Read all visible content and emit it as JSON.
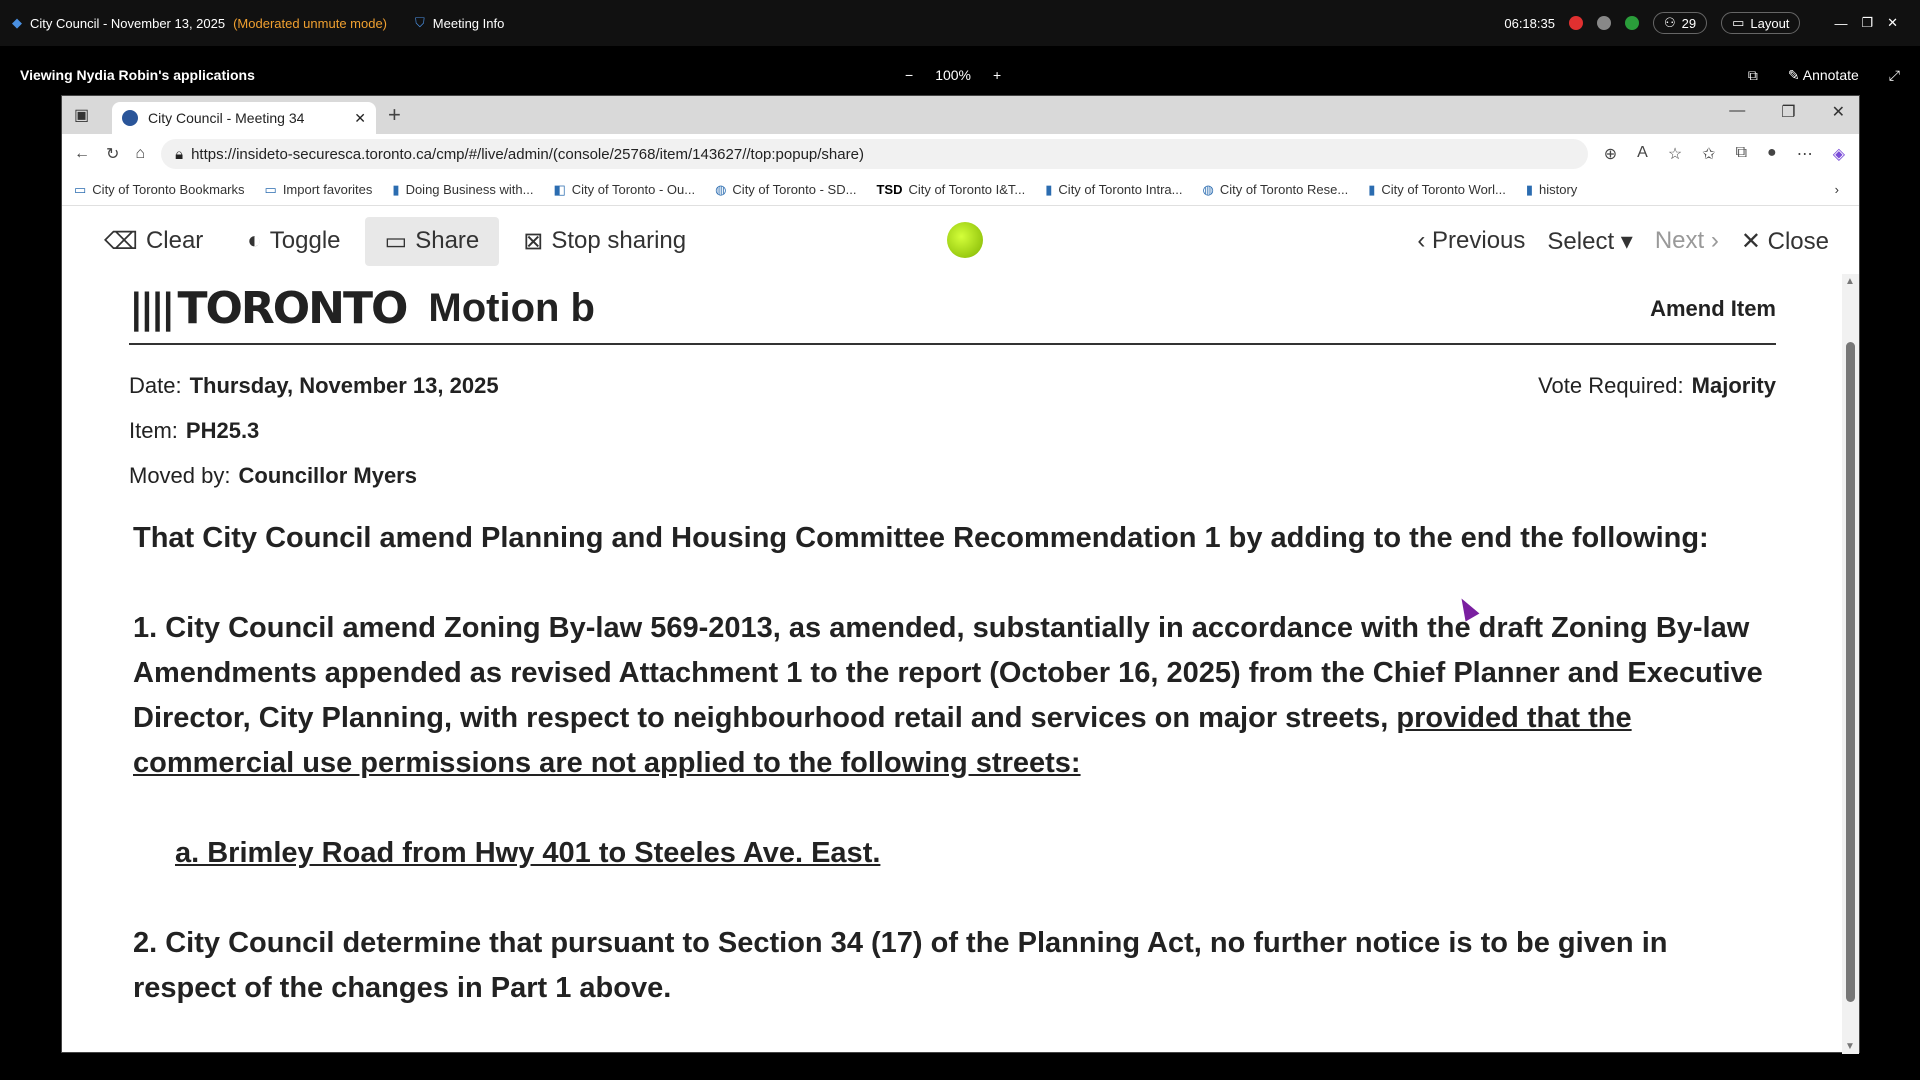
{
  "teams": {
    "meeting_title": "City Council - November 13, 2025",
    "mode": "(Moderated unmute mode)",
    "meeting_info": "Meeting Info",
    "time": "06:18:35",
    "participants": "29",
    "layout": "Layout"
  },
  "viewing": {
    "label": "Viewing Nydia Robin's applications",
    "zoom": "100%",
    "annotate": "Annotate"
  },
  "browser": {
    "tab_title": "City Council - Meeting 34",
    "url": "https://insideto-securesca.toronto.ca/cmp/#/live/admin/(console/25768/item/143627//top:popup/share)",
    "bookmarks": [
      "City of Toronto Bookmarks",
      "Import favorites",
      "Doing Business with...",
      "City of Toronto - Ou...",
      "City of Toronto - SD...",
      "City of Toronto I&T...",
      "City of Toronto Intra...",
      "City of Toronto Rese...",
      "City of Toronto Worl...",
      "history"
    ]
  },
  "toolbar": {
    "clear": "Clear",
    "toggle": "Toggle",
    "share": "Share",
    "stop_sharing": "Stop sharing",
    "previous": "Previous",
    "select": "Select",
    "next": "Next",
    "close": "Close"
  },
  "document": {
    "logo": "TORONTO",
    "motion": "Motion b",
    "amend_item": "Amend Item",
    "date_label": "Date:",
    "date": "Thursday, November 13, 2025",
    "vote_label": "Vote Required:",
    "vote": "Majority",
    "item_label": "Item:",
    "item": "PH25.3",
    "moved_label": "Moved by:",
    "moved": "Councillor Myers",
    "intro": "That City Council amend Planning and Housing Committee Recommendation 1 by adding to the end the following:",
    "p1": "1. City Council amend Zoning By-law 569-2013, as amended, substantially in accordance with the draft Zoning By-law Amendments appended as revised Attachment 1 to the report (October 16, 2025) from the Chief Planner and Executive Director, City Planning, with respect to neighbourhood retail and services on major streets,",
    "p1_underlined": "provided that the commercial use permissions are not applied to the following streets:",
    "p1a": "a. Brimley Road from Hwy 401 to Steeles Ave. East.",
    "p2": "2. City Council determine that pursuant to Section 34 (17) of the Planning Act, no further notice is to be given in respect of the changes in Part 1 above."
  }
}
